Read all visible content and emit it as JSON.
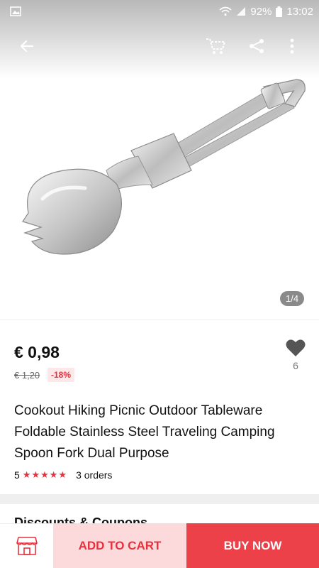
{
  "status_bar": {
    "battery": "92%",
    "time": "13:02"
  },
  "gallery": {
    "page_indicator": "1/4"
  },
  "product": {
    "price": "€ 0,98",
    "old_price": "€ 1,20",
    "discount": "-18%",
    "wishlist_count": "6",
    "title": "Cookout Hiking Picnic Outdoor Tableware Foldable Stainless Steel Traveling Camping Spoon Fork Dual Purpose",
    "rating": "5",
    "stars": "★★★★★",
    "orders": "3 orders"
  },
  "sections": {
    "coupons_title": "Discounts & Coupons"
  },
  "bottom_bar": {
    "add_to_cart": "ADD TO CART",
    "buy_now": "BUY NOW"
  },
  "colors": {
    "accent": "#e5323e",
    "buy_now_bg": "#ec4148",
    "add_to_cart_bg": "#fcd9da"
  },
  "icons": {
    "back": "arrow-left-icon",
    "cart": "cart-icon",
    "share": "share-icon",
    "more": "more-vert-icon",
    "wishlist": "heart-icon",
    "store": "store-icon"
  }
}
